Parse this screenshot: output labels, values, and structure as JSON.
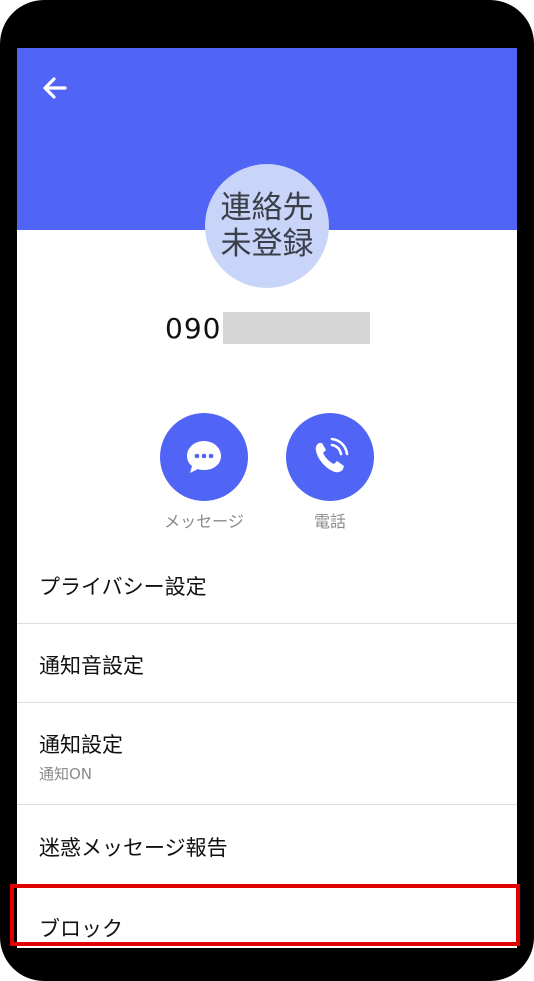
{
  "contact": {
    "avatar_text": "連絡先\n未登録",
    "number_prefix": "090"
  },
  "actions": [
    {
      "label": "メッセージ",
      "icon": "message-bubble-icon"
    },
    {
      "label": "電話",
      "icon": "phone-call-icon"
    }
  ],
  "menu": {
    "items": [
      {
        "title": "プライバシー設定"
      },
      {
        "title": "通知音設定"
      },
      {
        "title": "通知設定",
        "subtitle": "通知ON"
      },
      {
        "title": "迷惑メッセージ報告"
      },
      {
        "title": "ブロック"
      }
    ]
  },
  "colors": {
    "accent": "#5064F5",
    "avatar_bg": "#C8D4F8",
    "highlight": "#E00000"
  }
}
